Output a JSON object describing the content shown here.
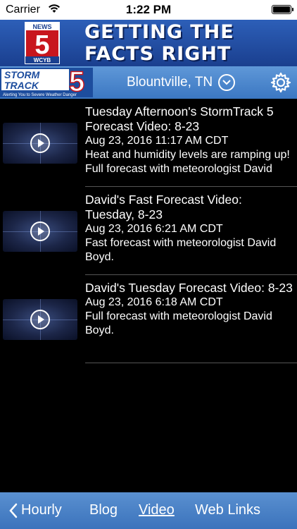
{
  "status_bar": {
    "carrier": "Carrier",
    "time": "1:22 PM"
  },
  "banner": {
    "logo_top": "NEWS",
    "logo_number": "5",
    "logo_bottom": "WCYB",
    "headline_line1": "GETTING THE",
    "headline_line2": "FACTS RIGHT"
  },
  "header": {
    "logo_word1": "STORM",
    "logo_word2": "TRACK",
    "logo_number": "5",
    "logo_tagline": "Alerting You to Severe Weather Danger",
    "location": "Blountville, TN"
  },
  "videos": [
    {
      "title": "Tuesday Afternoon's StormTrack 5 Forecast Video: 8-23",
      "date": "Aug 23, 2016 11:17 AM CDT",
      "description": "Heat and humidity levels are ramping up! Full forecast with meteorologist David Boyd."
    },
    {
      "title": "David's Fast Forecast Video: Tuesday, 8-23",
      "date": "Aug 23, 2016 6:21 AM CDT",
      "description": "Fast forecast with meteorologist David Boyd."
    },
    {
      "title": "David's Tuesday Forecast Video: 8-23",
      "date": "Aug 23, 2016 6:18 AM CDT",
      "description": "Full forecast with meteorologist David Boyd."
    }
  ],
  "tabs": {
    "hourly": "Hourly",
    "blog": "Blog",
    "video": "Video",
    "web_links": "Web Links"
  },
  "colors": {
    "header_blue": "#4a86cc",
    "banner_blue": "#2250a8",
    "background": "#000000"
  }
}
